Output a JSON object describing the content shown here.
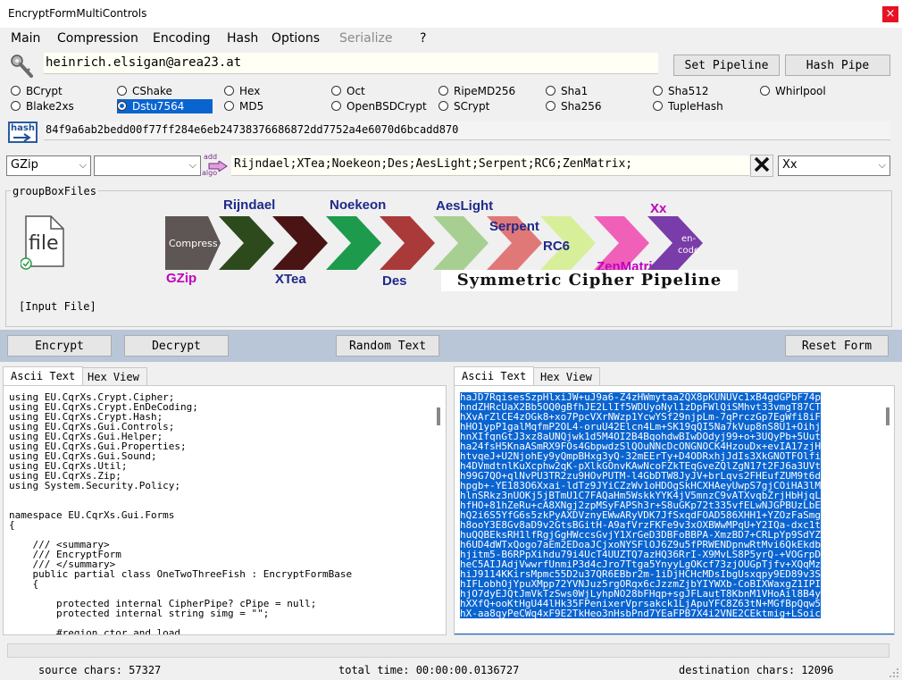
{
  "window": {
    "title": "EncryptFormMultiControls"
  },
  "menu": {
    "items": [
      {
        "label": "Main",
        "disabled": false
      },
      {
        "label": "Compression",
        "disabled": false
      },
      {
        "label": "Encoding",
        "disabled": false
      },
      {
        "label": "Hash",
        "disabled": false
      },
      {
        "label": "Options",
        "disabled": false
      },
      {
        "label": "Serialize",
        "disabled": true
      },
      {
        "label": "?",
        "disabled": false
      }
    ]
  },
  "key": {
    "value": "heinrich.elsigan@area23.at",
    "set_pipeline": "Set Pipeline",
    "hash_pipe": "Hash Pipe"
  },
  "hash_algorithms": [
    "BCrypt",
    "CShake",
    "Hex",
    "Oct",
    "RipeMD256",
    "Sha1",
    "Sha512",
    "Whirlpool",
    "Blake2xs",
    "Dstu7564",
    "MD5",
    "OpenBSDCrypt",
    "SCrypt",
    "Sha256",
    "TupleHash"
  ],
  "hash_selected": "Dstu7564",
  "hash_icon_label": "hash",
  "hash_value": "84f9a6ab2bedd00f77ff284e6eb24738376686872dd7752a4e6070d6bcadd870",
  "compression": {
    "selected": "GZip"
  },
  "add_algo_label": [
    "add",
    "algo"
  ],
  "pipeline_text": "Rijndael;XTea;Noekeon;Des;AesLight;Serpent;RC6;ZenMatrix;",
  "encoding": {
    "selected": "Xx"
  },
  "groupbox": {
    "label": "groupBoxFiles",
    "file_label": "file",
    "input_file": "[Input File]"
  },
  "pipeline_visual": {
    "stages": [
      {
        "label": "Compress",
        "algo": "GZip",
        "color": "#5e5654"
      },
      {
        "label": "",
        "algo": "Rijndael",
        "color": "#2d4a1c"
      },
      {
        "label": "",
        "algo": "XTea",
        "color": "#4a1414"
      },
      {
        "label": "",
        "algo": "Noekeon",
        "color": "#1e9a4c"
      },
      {
        "label": "",
        "algo": "Des",
        "color": "#aa3a3a"
      },
      {
        "label": "",
        "algo": "AesLight",
        "color": "#a8cf92"
      },
      {
        "label": "",
        "algo": "Serpent",
        "color": "#e07878"
      },
      {
        "label": "",
        "algo": "RC6",
        "color": "#d8ef9a"
      },
      {
        "label": "",
        "algo": "ZenMatrix",
        "color": "#f060b8"
      },
      {
        "label": "en-code",
        "algo": "Xx",
        "color": "#7a3ca8"
      }
    ],
    "title": "Symmetric Cipher Pipeline"
  },
  "actions": {
    "encrypt": "Encrypt",
    "decrypt": "Decrypt",
    "random_text": "Random Text",
    "reset_form": "Reset Form"
  },
  "left_tabs": [
    "Ascii Text",
    "Hex View"
  ],
  "right_tabs": [
    "Ascii Text",
    "Hex View"
  ],
  "source_text": [
    "using EU.CqrXs.Crypt.Cipher;",
    "using EU.CqrXs.Crypt.EnDeCoding;",
    "using EU.CqrXs.Crypt.Hash;",
    "using EU.CqrXs.Gui.Controls;",
    "using EU.CqrXs.Gui.Helper;",
    "using EU.CqrXs.Gui.Properties;",
    "using EU.CqrXs.Gui.Sound;",
    "using EU.CqrXs.Util;",
    "using EU.CqrXs.Zip;",
    "using System.Security.Policy;",
    "",
    "",
    "namespace EU.CqrXs.Gui.Forms",
    "{",
    "",
    "    /// <summary>",
    "    /// EncryptForm",
    "    /// </summary>",
    "    public partial class OneTwoThreeFish : EncryptFormBase",
    "    {",
    "",
    "        protected internal CipherPipe? cPipe = null;",
    "        protected internal string simg = \"\";",
    "",
    "        #region ctor and load"
  ],
  "dest_text": [
    "haJD7RqisesSzpHlxiJW+uJ9a6-Z4zHWmytaa2QX8pKUNUVc1xB4gdGPbF74p",
    "hndZHRcUaX2Bb5OQ0gBfhJE2LlIf5WDUyoNyl1zDpFWlQiSMhvt33vmgT87CT",
    "hXvArZlCE4zOGk8+xo7PpcVXrNWzp1YcwYSf29njpLm-7qPrczGp7EgWfi8iF",
    "hHO1ypP1galMqfmP2OL4-oruU42Elcn4Lm+SK19qQI5Na7kVup8nS8U1+Oihj",
    "hnXIfqnGtJ3xz8aUNQjwk1d5M4OI2B4BqohdwBIwDOdyj99+o+3UQyPb+5Uut",
    "ha24fsH5KnaASmRX9FOs4GbpwdzSlQOuNNcDcONGNOCK4HzouDx+evIA17zjH",
    "htvqeJ+U2NjohEy9yQmpBHxg3yQ-32mEErTy+D4ODRxhjJdIs3XkGNOTFOlfi",
    "h4DVmdtnlKuXcphw2qK-pXlkGOnvKAwNcoFZkTEqGveZQlZgN17t2FJ6a3UVt",
    "h99G7QO+qlNvPU3TR2zu9HOvPUTM-l4GbDTW8JyJV+brLqvs2FHEufZUM9t6d",
    "hpgb+-YE183O6Xxai-ldTz9JYiCZzWv1oHDOgSkHCXHAeyUwpS7gjCOiHA3lM",
    "hlnSRkz3nUOKj5jBTmU1C7FAQaHm5WskkYYK4jV5mnzC9vATXvqbZrjHbHjqL",
    "hfHO+81hZeRu+cA8XNgj2zpMSyFAPSh3r+S8uGKp72t335vfELwNJGPBUzLbE",
    "hQ2i6S5YfG6s5zkPyAXDVznyEWwARyVDK7JfSxqdFOAD586XHH1+YZOzFaSmg",
    "h8ooY3E8Gv8aD9v2GtsBGitH-A9afVrzFKFe9v3xOXBWwMPqU+Y2IQa-dxc1t",
    "huQQBEksRH1lfRgjGgHWccsGvjY1XrGeD3DBFoBBPA-XmzBD7+CRLpYp9SdYZ",
    "h6UD4dWTxQogo7aEm2EDoaJCjxoNYSFlOJ6Z9u5fPRWENDpnwRtMvi6QkEkdb",
    "hjitm5-B6RPpXihdu79i4UcT4UUZTQ7azHQ36RrI-X9MvLS8P5yrQ-+VOGrpD",
    "heC5AIJAdjVwwrfUnmiP3d4cJro7Ttga5YnyyLgOKcf73zjOUGpTjfv+XQqMz",
    "hiJ9114KKirsMpmc55D2u37QR6EBbr2m-1iDjHCHcMDsIbgUsxqpy9ED89v3S",
    "hIFLobhOjYpuXMpp72YVNJuz5rgORqx6cJzzmZjbYIYWXb-CoBIXWaxgZ1IPI",
    "hjO7dyEJQtJmVkTzSws0WjLyhpNO28bFHqp+sgJFLautT8KbnM1VHoAil8B4y",
    "hXXfQ+ooKtHgU44lHk35FPenixerVprsakck1LjApuYFC8Z63tN+MGfBpQqw5",
    "hX-aa8qyPeCWq4xF9E2TkHeo3nHsbPnd7YEaFPB7X4i2VNE2CEktmig+LSoic"
  ],
  "status": {
    "source": "source chars: 57327",
    "time": "total time: 00:00:00.0136727",
    "dest": "destination chars: 12096"
  }
}
